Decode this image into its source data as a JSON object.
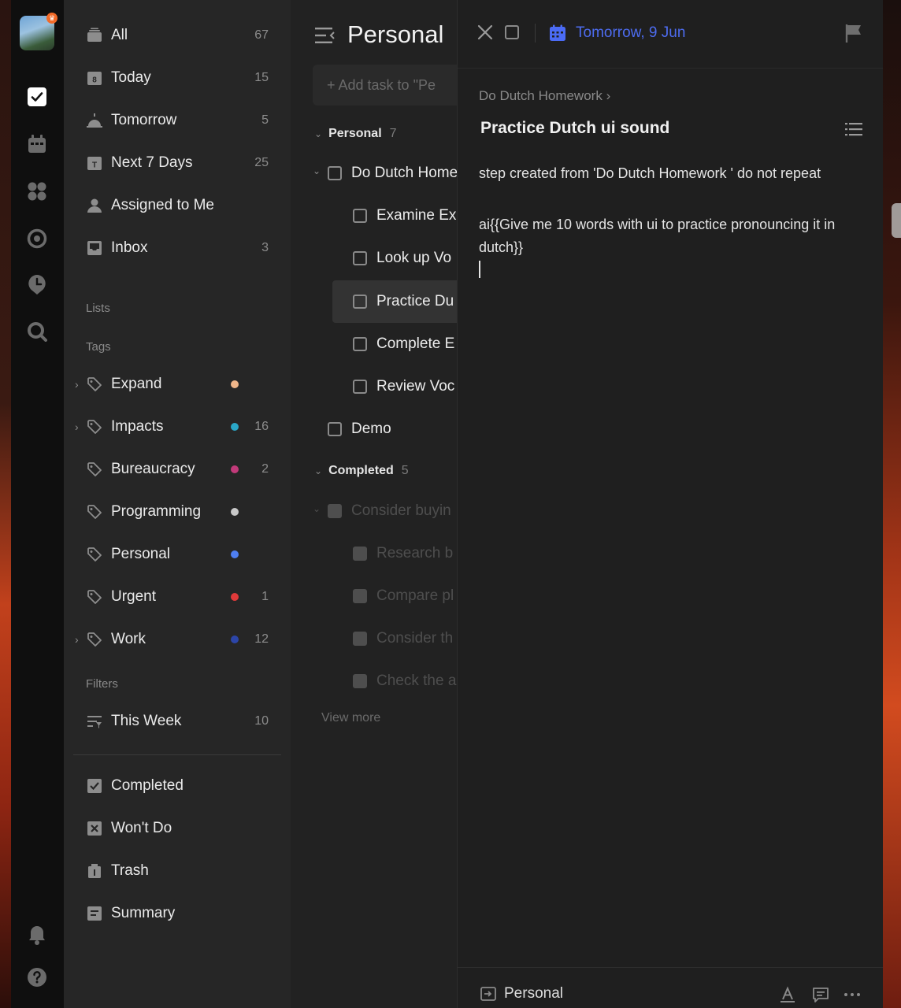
{
  "colors": {
    "accent": "#4d6cf0",
    "rail_bg": "#0f0f0f",
    "sidebar_bg": "#262626",
    "detail_bg": "#1f1f1f"
  },
  "rail": {
    "icons": [
      "check-square-icon",
      "calendar-icon",
      "grid-icon",
      "target-icon",
      "clock-pin-icon",
      "search-icon",
      "bell-icon",
      "help-icon"
    ]
  },
  "sidebar": {
    "smart_lists": [
      {
        "label": "All",
        "count": "67",
        "icon": "stack-icon"
      },
      {
        "label": "Today",
        "count": "15",
        "icon": "calendar-day-icon"
      },
      {
        "label": "Tomorrow",
        "count": "5",
        "icon": "sunrise-icon"
      },
      {
        "label": "Next 7 Days",
        "count": "25",
        "icon": "calendar-week-icon"
      },
      {
        "label": "Assigned to Me",
        "count": "",
        "icon": "person-icon"
      },
      {
        "label": "Inbox",
        "count": "3",
        "icon": "inbox-icon"
      }
    ],
    "lists_heading": "Lists",
    "tags_heading": "Tags",
    "tags": [
      {
        "label": "Expand",
        "count": "",
        "color": "#f0b68a",
        "expandable": true
      },
      {
        "label": "Impacts",
        "count": "16",
        "color": "#2aa7c7",
        "expandable": true
      },
      {
        "label": "Bureaucracy",
        "count": "2",
        "color": "#c23a7a",
        "expandable": false
      },
      {
        "label": "Programming",
        "count": "",
        "color": "#c8c8c8",
        "expandable": false
      },
      {
        "label": "Personal",
        "count": "",
        "color": "#4f7ff2",
        "expandable": false
      },
      {
        "label": "Urgent",
        "count": "1",
        "color": "#e03a3a",
        "expandable": false
      },
      {
        "label": "Work",
        "count": "12",
        "color": "#2c45a8",
        "expandable": true
      }
    ],
    "filters_heading": "Filters",
    "filters": [
      {
        "label": "This Week",
        "count": "10"
      }
    ],
    "bottom": [
      {
        "label": "Completed",
        "icon": "checked-box-icon"
      },
      {
        "label": "Won't Do",
        "icon": "x-box-icon"
      },
      {
        "label": "Trash",
        "icon": "trash-icon"
      },
      {
        "label": "Summary",
        "icon": "summary-icon"
      }
    ]
  },
  "task_list": {
    "title": "Personal",
    "add_placeholder": "+ Add task to \"Pe",
    "groups": [
      {
        "label": "Personal",
        "count": "7"
      },
      {
        "label": "Completed",
        "count": "5"
      }
    ],
    "tasks": [
      {
        "label": "Do Dutch Home"
      },
      {
        "label": "Examine Ex"
      },
      {
        "label": "Look up Vo"
      },
      {
        "label": "Practice Du"
      },
      {
        "label": "Complete E"
      },
      {
        "label": "Review Voc"
      },
      {
        "label": "Demo"
      }
    ],
    "completed": [
      {
        "label": "Consider buyin"
      },
      {
        "label": "Research b"
      },
      {
        "label": "Compare pl"
      },
      {
        "label": "Consider th"
      },
      {
        "label": "Check the a"
      }
    ],
    "view_more": "View more"
  },
  "detail": {
    "date": "Tomorrow, 9 Jun",
    "breadcrumb": "Do Dutch Homework",
    "breadcrumb_sep": "›",
    "title": "Practice Dutch ui sound",
    "description_1": "step created from 'Do Dutch Homework ' do not repeat",
    "description_2": "ai{{Give me 10 words with ui to practice pronouncing it in dutch}}",
    "project": "Personal"
  }
}
